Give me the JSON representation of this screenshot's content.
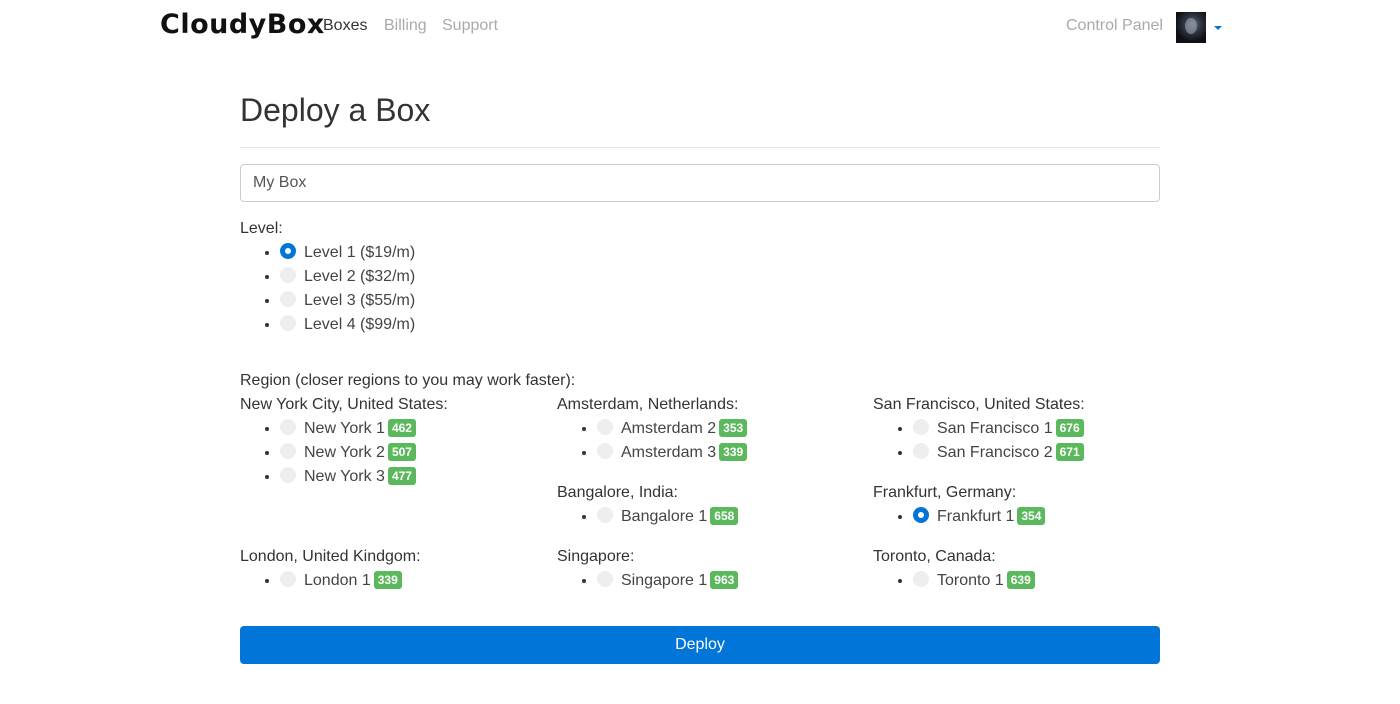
{
  "nav": {
    "brand": "CloudyBox",
    "links": [
      "Boxes",
      "Billing",
      "Support"
    ],
    "control_panel": "Control Panel"
  },
  "page": {
    "title": "Deploy a Box",
    "box_name_value": "My Box"
  },
  "level": {
    "label": "Level:",
    "options": [
      "Level 1 ($19/m)",
      "Level 2 ($32/m)",
      "Level 3 ($55/m)",
      "Level 4 ($99/m)"
    ],
    "selected": "Level 1 ($19/m)"
  },
  "region": {
    "label": "Region (closer regions to you may work faster):",
    "groups": [
      {
        "name": "New York City, United States:",
        "options": [
          {
            "name": "New York 1",
            "badge": "462"
          },
          {
            "name": "New York 2",
            "badge": "507"
          },
          {
            "name": "New York 3",
            "badge": "477"
          }
        ]
      },
      {
        "name": "Amsterdam, Netherlands:",
        "options": [
          {
            "name": "Amsterdam 2",
            "badge": "353"
          },
          {
            "name": "Amsterdam 3",
            "badge": "339"
          }
        ]
      },
      {
        "name": "San Francisco, United States:",
        "options": [
          {
            "name": "San Francisco 1",
            "badge": "676"
          },
          {
            "name": "San Francisco 2",
            "badge": "671"
          }
        ]
      },
      {
        "name": "Bangalore, India:",
        "options": [
          {
            "name": "Bangalore 1",
            "badge": "658"
          }
        ]
      },
      {
        "name": "Frankfurt, Germany:",
        "options": [
          {
            "name": "Frankfurt 1",
            "badge": "354"
          }
        ]
      },
      {
        "name": "London, United Kindgom:",
        "options": [
          {
            "name": "London 1",
            "badge": "339"
          }
        ]
      },
      {
        "name": "Singapore:",
        "options": [
          {
            "name": "Singapore 1",
            "badge": "963"
          }
        ]
      },
      {
        "name": "Toronto, Canada:",
        "options": [
          {
            "name": "Toronto 1",
            "badge": "639"
          }
        ]
      }
    ],
    "selected": "Frankfurt 1"
  },
  "deploy_label": "Deploy",
  "colors": {
    "accent": "#0275d8",
    "badge": "#5cb85c"
  }
}
